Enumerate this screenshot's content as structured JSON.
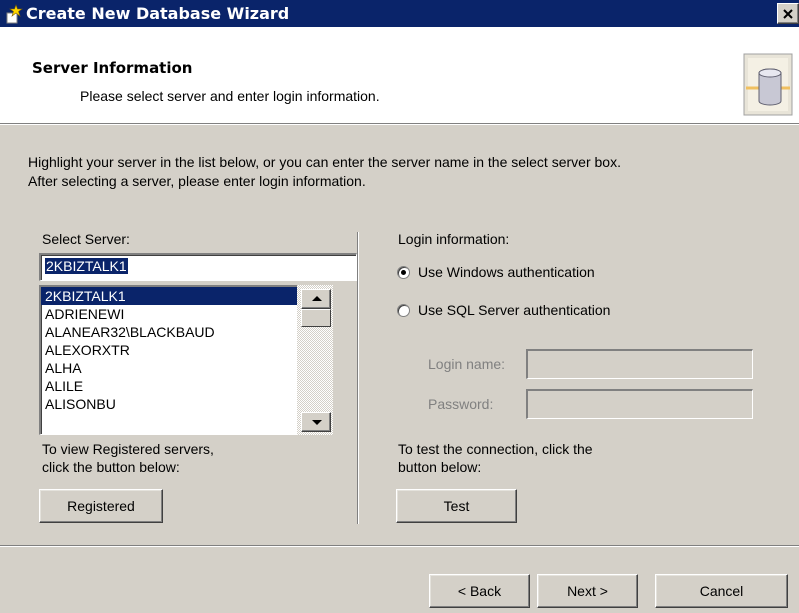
{
  "window": {
    "title": "Create New Database Wizard",
    "close_label": "×"
  },
  "header": {
    "title": "Server Information",
    "subtitle": "Please select server and enter login information."
  },
  "intro": {
    "line1": "Highlight your server in the list below, or you can enter the server name in the select server box.",
    "line2": "After selecting a server, please enter login information."
  },
  "server": {
    "label": "Select Server:",
    "value": "2KBIZTALK1",
    "list": [
      "2KBIZTALK1",
      "ADRIENEWI",
      "ALANEAR32\\BLACKBAUD",
      "ALEXORXTR",
      "ALHA",
      "ALILE",
      "ALISONBU"
    ],
    "selected_index": 0,
    "registered_hint_1": "To view Registered servers,",
    "registered_hint_2": "click the button below:",
    "registered_button": "Registered"
  },
  "login": {
    "label": "Login information:",
    "windows_auth": "Use Windows authentication",
    "sql_auth": "Use SQL Server authentication",
    "selected": "windows",
    "login_name_label": "Login name:",
    "login_name_value": "",
    "password_label": "Password:",
    "password_value": "",
    "test_hint_1": "To test the connection, click the",
    "test_hint_2": "button below:",
    "test_button": "Test"
  },
  "footer": {
    "back_button": "< Back",
    "next_button": "Next >",
    "cancel_button": "Cancel"
  },
  "colors": {
    "title_bar": "#0a246a",
    "selection": "#0a246a",
    "face": "#d4d0c8"
  }
}
